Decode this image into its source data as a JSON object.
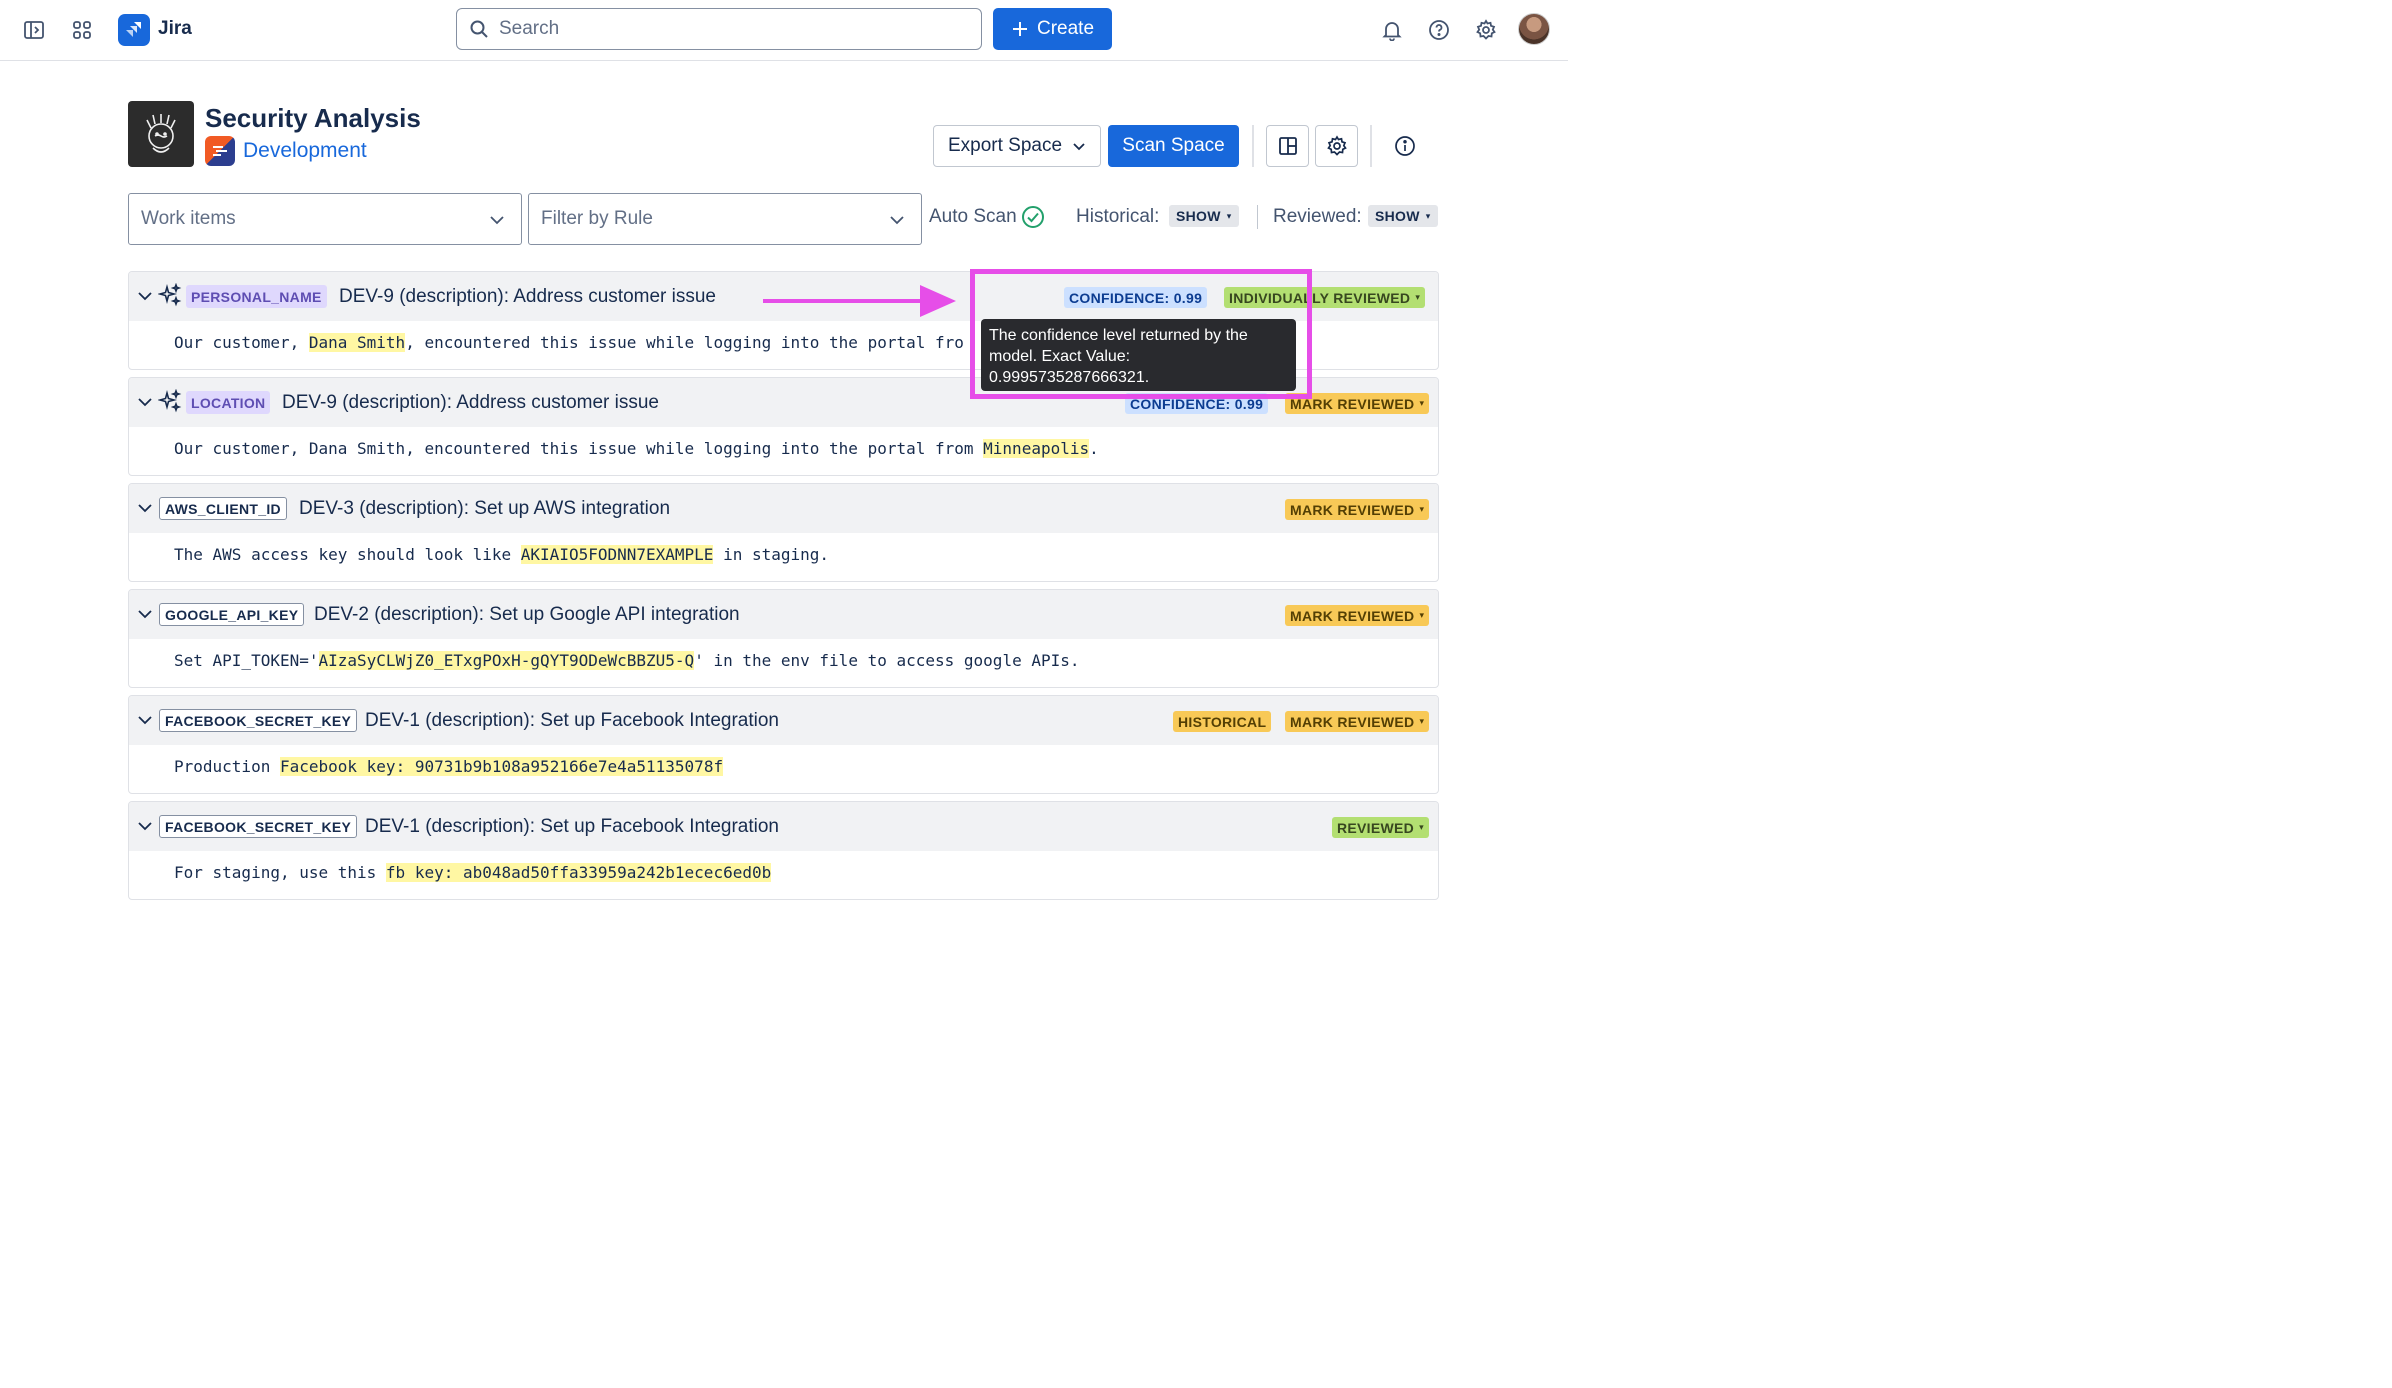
{
  "nav": {
    "app_name": "Jira",
    "search_placeholder": "Search",
    "create_label": "Create"
  },
  "header": {
    "title": "Security Analysis",
    "project": "Development",
    "export_label": "Export Space",
    "scan_label": "Scan Space"
  },
  "filters": {
    "work_items_placeholder": "Work items",
    "rule_placeholder": "Filter by Rule",
    "auto_scan_label": "Auto Scan",
    "historical_label": "Historical:",
    "historical_value": "SHOW",
    "reviewed_label": "Reviewed:",
    "reviewed_value": "SHOW"
  },
  "tooltip": {
    "text": "The confidence level returned by the model. Exact Value: 0.9995735287666321."
  },
  "findings": [
    {
      "type": "PERSONAL_NAME",
      "title": "DEV-9 (description): Address customer issue",
      "confidence": "CONFIDENCE: 0.99",
      "status": "INDIVIDUALLY REVIEWED",
      "body_pre": "Our customer, ",
      "body_hl": "Dana Smith",
      "body_post": ", encountered this issue while logging into the portal fro"
    },
    {
      "type": "LOCATION",
      "title": "DEV-9 (description): Address customer issue",
      "confidence": "CONFIDENCE: 0.99",
      "status": "MARK REVIEWED",
      "body_pre": "Our customer, Dana Smith, encountered this issue while logging into the portal from ",
      "body_hl": "Minneapolis",
      "body_post": "."
    },
    {
      "type": "AWS_CLIENT_ID",
      "title": "DEV-3 (description): Set up AWS integration",
      "status": "MARK REVIEWED",
      "body_pre": "The AWS access key should look like ",
      "body_hl": "AKIAIO5FODNN7EXAMPLE",
      "body_post": " in staging."
    },
    {
      "type": "GOOGLE_API_KEY",
      "title": "DEV-2 (description): Set up Google API integration",
      "status": "MARK REVIEWED",
      "body_pre": "Set API_TOKEN='",
      "body_hl": "AIzaSyCLWjZ0_ETxgPOxH-gQYT9ODeWcBBZU5-Q",
      "body_post": "' in the env file to access google APIs."
    },
    {
      "type": "FACEBOOK_SECRET_KEY",
      "title": "DEV-1 (description): Set up Facebook Integration",
      "historical": "HISTORICAL",
      "status": "MARK REVIEWED",
      "body_pre": "Production ",
      "body_hl": "Facebook key: 90731b9b108a952166e7e4a51135078f",
      "body_post": ""
    },
    {
      "type": "FACEBOOK_SECRET_KEY",
      "title": "DEV-1 (description): Set up Facebook Integration",
      "status": "REVIEWED",
      "body_pre": "For staging, use this ",
      "body_hl": "fb key: ab048ad50ffa33959a242b1ecec6ed0b",
      "body_post": ""
    }
  ],
  "colors": {
    "brand": "#1868db",
    "annotation": "#e64ee8",
    "highlight": "#fff7a3"
  }
}
